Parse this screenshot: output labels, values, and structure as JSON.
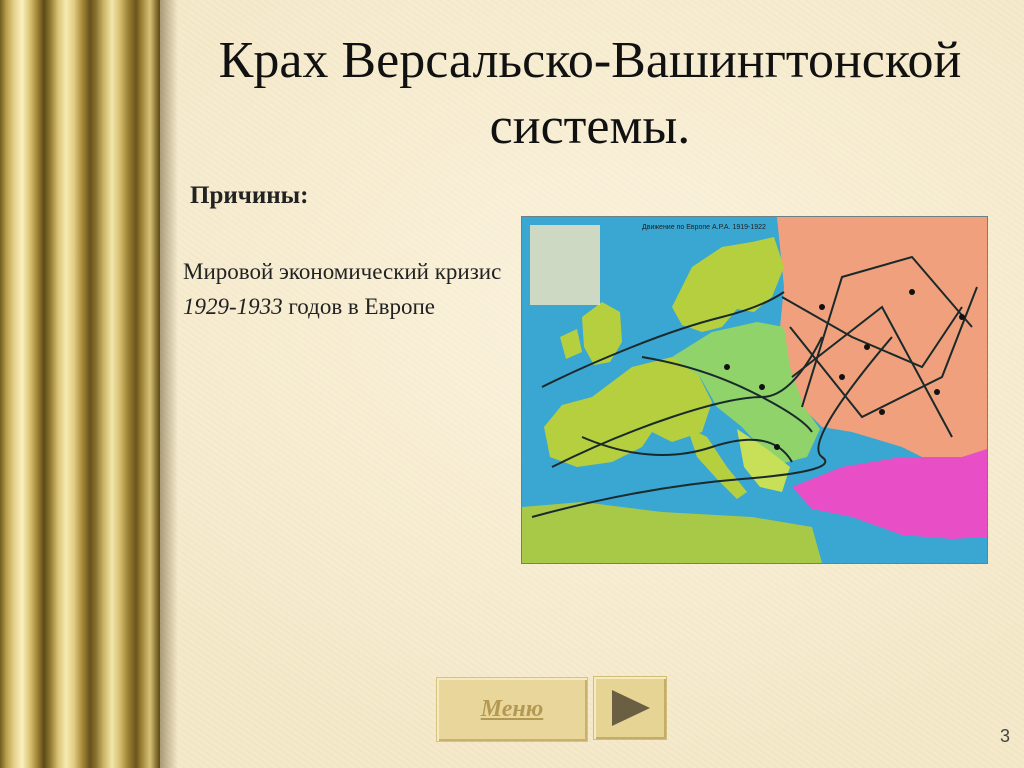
{
  "slide": {
    "title": "Крах Версальско-Вашингтонской системы.",
    "subheading": "Причины:",
    "body": {
      "part1": "Мировой экономический кризис ",
      "years": "1929-1933",
      "part2": " годов в Европе"
    },
    "page_number": "3"
  },
  "map": {
    "caption": "Движение по Европе А.Р.А. 1919-1922",
    "colors": {
      "sea": "#3aa6d2",
      "west": "#b6cf3e",
      "central": "#8fd36a",
      "east": "#f0a07c",
      "turkey": "#e84fc6",
      "routes": "#1a2a2a"
    }
  },
  "nav": {
    "menu_label": "Меню",
    "next_icon": "play-triangle-icon"
  },
  "theme": {
    "background": "#f4e8c8",
    "column": "#b69c48"
  }
}
